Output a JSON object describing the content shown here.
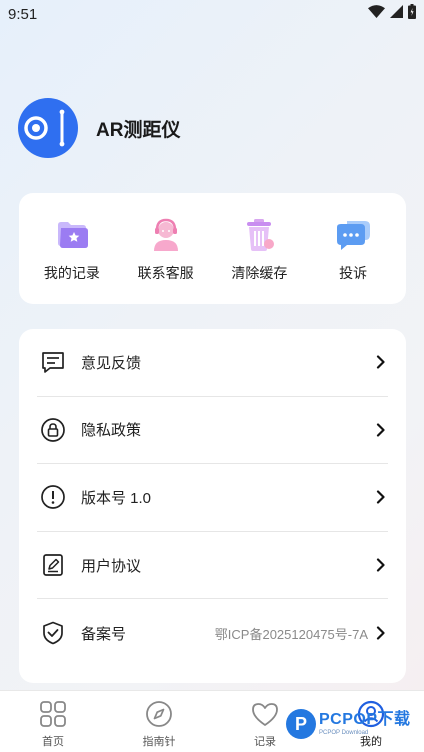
{
  "status_bar": {
    "time": "9:51"
  },
  "app": {
    "name": "AR测距仪"
  },
  "quick_actions": [
    {
      "label": "我的记录",
      "icon": "folder-star-icon"
    },
    {
      "label": "联系客服",
      "icon": "customer-service-icon"
    },
    {
      "label": "清除缓存",
      "icon": "trash-icon"
    },
    {
      "label": "投诉",
      "icon": "chat-bubble-icon"
    }
  ],
  "menu": [
    {
      "label": "意见反馈",
      "value": "",
      "icon": "feedback-icon"
    },
    {
      "label": "隐私政策",
      "value": "",
      "icon": "lock-icon"
    },
    {
      "label": "版本号 1.0",
      "value": "",
      "icon": "info-icon"
    },
    {
      "label": "用户协议",
      "value": "",
      "icon": "document-edit-icon"
    },
    {
      "label": "备案号",
      "value": "鄂ICP备2025120475号-7A",
      "icon": "shield-check-icon"
    }
  ],
  "bottom_nav": [
    {
      "label": "首页",
      "icon": "grid-icon",
      "active": false
    },
    {
      "label": "指南针",
      "icon": "compass-icon",
      "active": false
    },
    {
      "label": "记录",
      "icon": "heart-icon",
      "active": false
    },
    {
      "label": "我的",
      "icon": "profile-icon",
      "active": true
    }
  ],
  "watermark": {
    "text": "PCPOP下载",
    "subtext": "PCPOP Download",
    "badge": "P"
  },
  "colors": {
    "accent": "#2f6ff0",
    "watermark": "#2478e0",
    "quick_icon_purple": "#a98cf5",
    "quick_icon_pink": "#f08fc0",
    "quick_icon_blue": "#6fa8f5"
  }
}
